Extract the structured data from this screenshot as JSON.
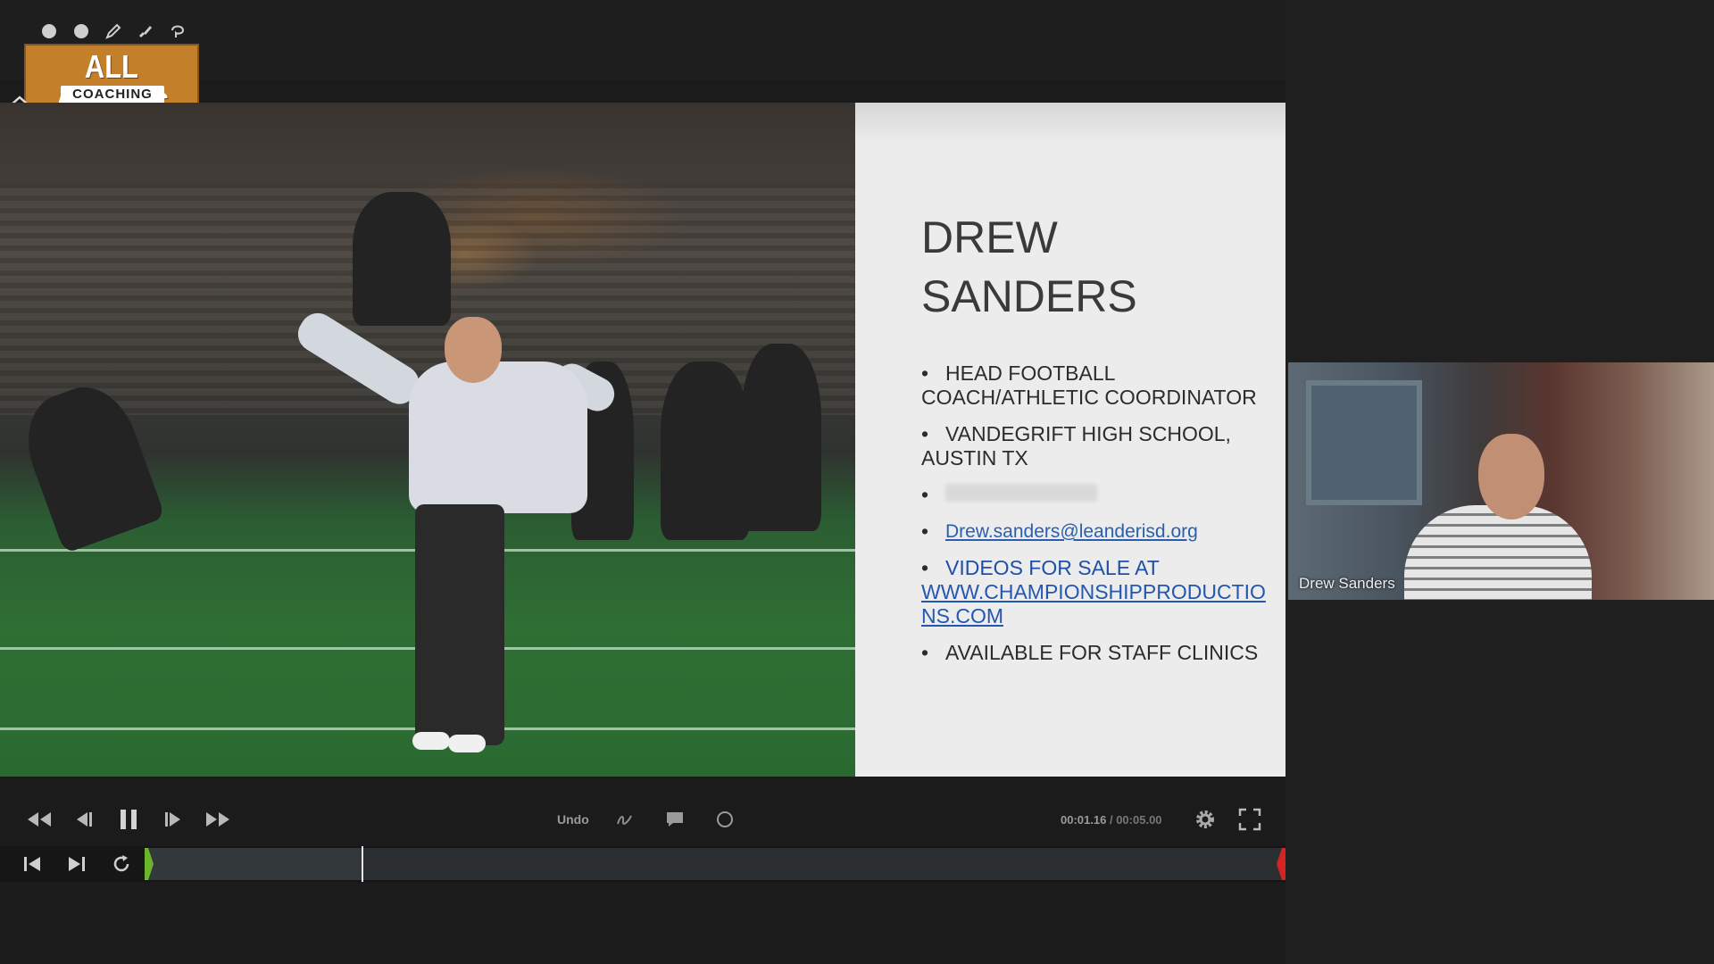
{
  "logo": {
    "title": "ALL ACCESS",
    "subtitle": "COACHING"
  },
  "tools": [
    "circle-icon",
    "circle-icon",
    "pencil-icon",
    "brush-icon",
    "lasso-icon"
  ],
  "slide": {
    "name": "DREW SANDERS",
    "name_line1": "DREW",
    "name_line2": "SANDERS",
    "bullets": [
      {
        "text": "HEAD FOOTBALL COACH/ATHLETIC COORDINATOR"
      },
      {
        "text": "VANDEGRIFT HIGH SCHOOL, AUSTIN TX"
      },
      {
        "text": ""
      },
      {
        "text": "Drew.sanders@leanderisd.org"
      },
      {
        "text": "VIDEOS FOR SALE AT",
        "link": "WWW.CHAMPIONSHIPPRODUCTIONS.COM"
      },
      {
        "text": "AVAILABLE FOR STAFF CLINICS"
      }
    ]
  },
  "player": {
    "undo_label": "Undo",
    "time_current": "00:01.16",
    "time_separator": "/",
    "time_total": "00:05.00",
    "progress": 0.19
  },
  "webcam": {
    "name": "Drew Sanders"
  },
  "colors": {
    "accent": "#c47f2a",
    "link": "#2a5fb0",
    "in_marker": "#6bb52c",
    "out_marker": "#d42323"
  }
}
